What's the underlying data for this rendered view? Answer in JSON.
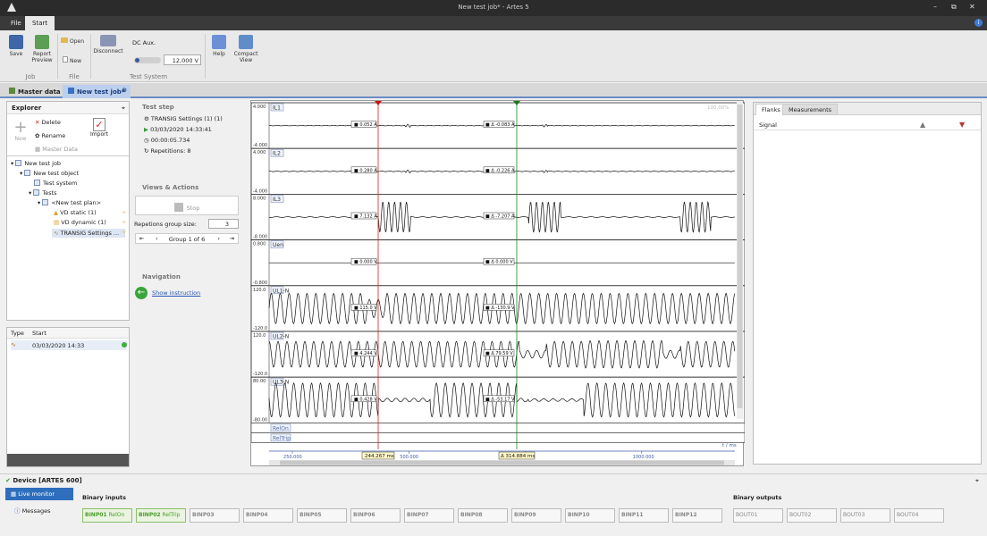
{
  "window": {
    "title": "New test job* - Artes 5"
  },
  "ribbon": {
    "tabs": [
      "File",
      "Start"
    ],
    "buttons": {
      "save": "Save",
      "report": "Report Preview",
      "open": "Open",
      "new": "New",
      "disconnect": "Disconnect",
      "help": "Help",
      "compact": "Compact View"
    },
    "groups": {
      "job": "Job",
      "file": "File",
      "test_system": "Test System"
    },
    "dc_aux_label": "DC Aux.",
    "dc_aux_value": "12,000 V"
  },
  "doc_tabs": [
    "Master data",
    "New test job*"
  ],
  "explorer": {
    "title": "Explorer",
    "actions": {
      "new": "New",
      "delete": "Delete",
      "rename": "Rename",
      "master_data": "Master Data",
      "import": "Import"
    },
    "tree": [
      "New test job",
      "New test object",
      "Test system",
      "Tests",
      "<New test plan>",
      "VD static (1)",
      "VD dynamic (1)",
      "TRANSIG Settings ..."
    ]
  },
  "runs": {
    "col_type": "Type",
    "col_start": "Start",
    "row_start": "03/03/2020 14:33"
  },
  "test_step": {
    "title": "Test step",
    "name": "TRANSIG Settings (1) (1)",
    "date": "03/03/2020 14:33:41",
    "duration": "00:00:05.734",
    "repetitions": "Repetitions: 8",
    "views_title": "Views & Actions",
    "stop": "Stop",
    "group_size_label": "Repetions group size:",
    "group_size": "3",
    "group_nav": "Group 1 of 6",
    "nav_title": "Navigation",
    "show_instruction": "Show instruction"
  },
  "chart_data": {
    "type": "line",
    "x_unit": "t / ms",
    "x_ticks": [
      "250.000",
      "500.000",
      "750.000",
      "1000.000"
    ],
    "xlim": [
      200,
      1200
    ],
    "cursor1_label": "244.267 ms",
    "cursor2_label": "314.884 ms",
    "zoom_label": "100.00%",
    "series": [
      {
        "name": "IL1",
        "ymax": "4.000",
        "ymin": "-4.000",
        "val1": "0.052 A",
        "val2": "Δ -0.083 A"
      },
      {
        "name": "IL2",
        "ymax": "4.000",
        "ymin": "-4.000",
        "val1": "0.280 A",
        "val2": "Δ -0.226 A"
      },
      {
        "name": "IL3",
        "ymax": "8.000",
        "ymin": "-8.000",
        "val1": "7.132 A",
        "val2": "Δ -7.207 A"
      },
      {
        "name": "Uen",
        "ymax": "0.800",
        "ymin": "-0.800",
        "val1": "0.000 V",
        "val2": "Δ 0.000 V"
      },
      {
        "name": "UL1-N",
        "ymax": "120.0",
        "ymin": "-120.0",
        "val1": "115.0 V",
        "val2": "Δ -130.9 V"
      },
      {
        "name": "UL2-N",
        "ymax": "120.0",
        "ymin": "-120.0",
        "val1": "4.244 V",
        "val2": "Δ 79.59 V"
      },
      {
        "name": "UL3-N",
        "ymax": "80.00",
        "ymin": "-80.00",
        "val1": "0.428 V",
        "val2": "Δ -53.17 V"
      }
    ],
    "digital": [
      "RelOn",
      "RelTrip"
    ]
  },
  "right_panel": {
    "tabs": [
      "Flanks",
      "Measurements"
    ],
    "col_signal": "Signal"
  },
  "device": {
    "title": "Device [ARTES 600]",
    "live_monitor": "Live monitor",
    "messages": "Messages",
    "binary_inputs_title": "Binary inputs",
    "binary_outputs_title": "Binary outputs",
    "binary_inputs": [
      {
        "id": "BINP01",
        "label": "RelOn"
      },
      {
        "id": "BINP02",
        "label": "RelTrip"
      },
      {
        "id": "BINP03",
        "label": ""
      },
      {
        "id": "BINP04",
        "label": ""
      },
      {
        "id": "BINP05",
        "label": ""
      },
      {
        "id": "BINP06",
        "label": ""
      },
      {
        "id": "BINP07",
        "label": ""
      },
      {
        "id": "BINP08",
        "label": ""
      },
      {
        "id": "BINP09",
        "label": ""
      },
      {
        "id": "BINP10",
        "label": ""
      },
      {
        "id": "BINP11",
        "label": ""
      },
      {
        "id": "BINP12",
        "label": ""
      }
    ],
    "binary_outputs": [
      "BOUT01",
      "BOUT02",
      "BOUT03",
      "BOUT04"
    ]
  }
}
